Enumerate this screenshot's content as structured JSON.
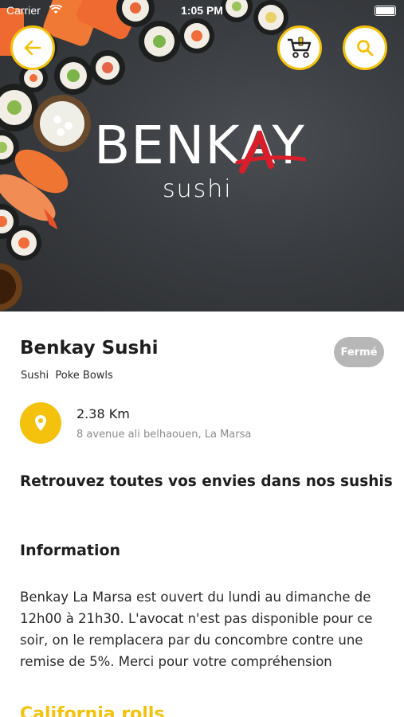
{
  "status_bar": {
    "carrier": "Carrier",
    "time": "1:05 PM"
  },
  "header": {
    "back_icon": "arrow-left-icon",
    "cart_icon": "cart-icon",
    "search_icon": "search-icon",
    "accent_color": "#f4c20d"
  },
  "logo": {
    "word": "BENKAY",
    "sub": "sushi",
    "accent_color": "#d81e2b"
  },
  "restaurant": {
    "name": "Benkay Sushi",
    "status": "Fermé",
    "categories": "Sushi  Poke Bowls",
    "distance": "2.38 Km",
    "address": "8 avenue ali belhaouen, La Marsa",
    "tagline": "Retrouvez toutes vos envies dans nos sushis"
  },
  "information": {
    "title": "Information",
    "text": "Benkay La Marsa est ouvert du lundi au dimanche de 12h00 à 21h30. L'avocat n'est pas disponible pour ce soir, on le remplacera par du concombre contre une remise de 5%. Merci pour votre compréhension"
  },
  "next_section": {
    "title": "California rolls"
  }
}
